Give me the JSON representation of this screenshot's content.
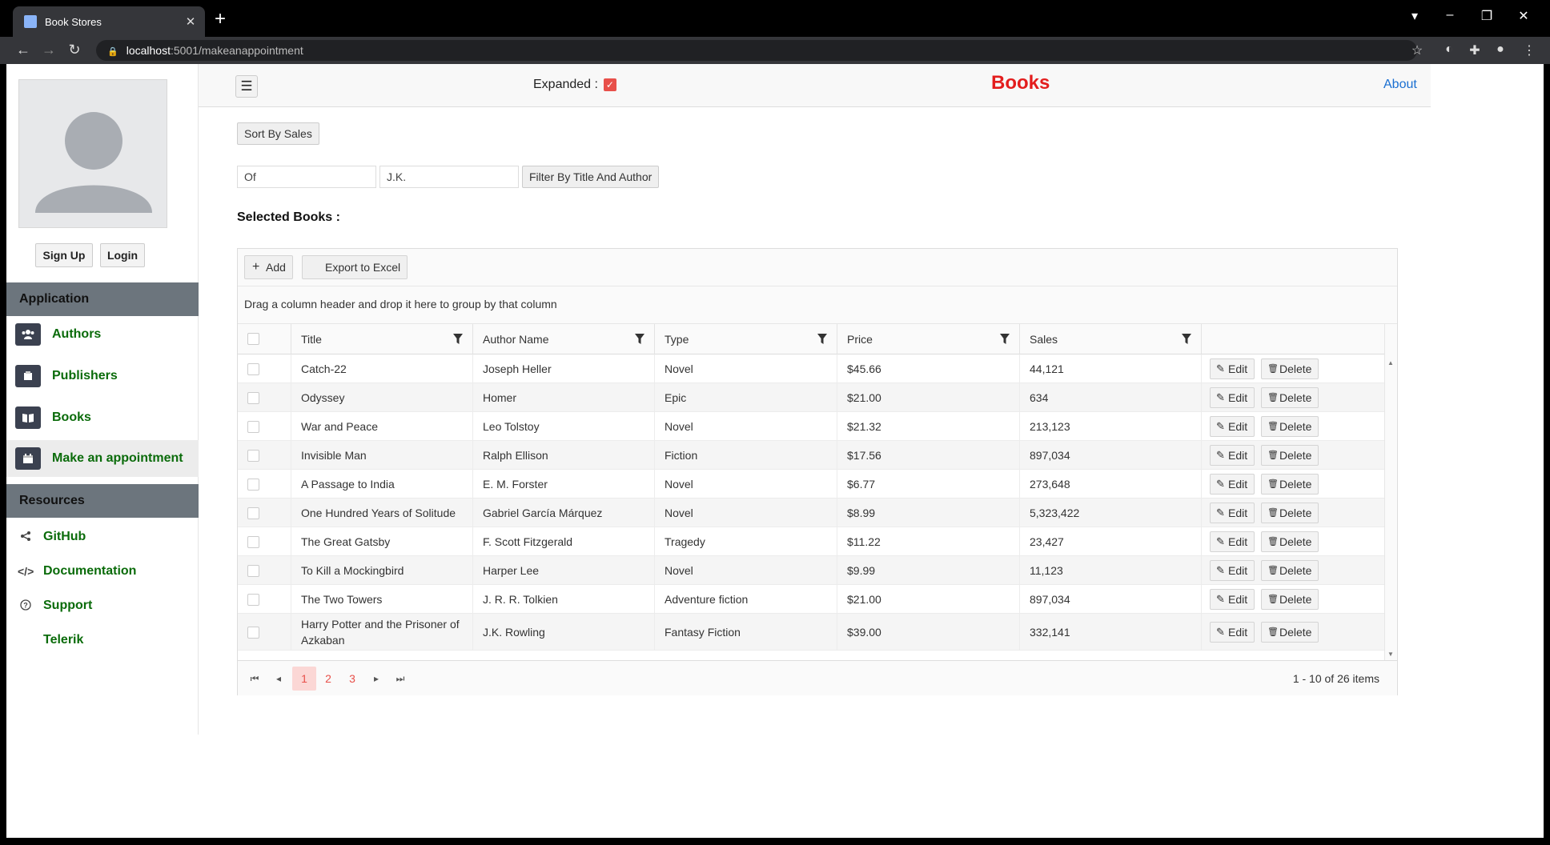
{
  "browser": {
    "tab_title": "Book Stores",
    "url_host": "localhost",
    "url_rest": ":5001/makeanappointment"
  },
  "sidebar": {
    "sign_up": "Sign Up",
    "login": "Login",
    "application_header": "Application",
    "app_items": [
      {
        "label": "Authors",
        "icon": "users-icon"
      },
      {
        "label": "Publishers",
        "icon": "publisher-icon"
      },
      {
        "label": "Books",
        "icon": "book-icon"
      },
      {
        "label": "Make an appointment",
        "icon": "calendar-icon"
      }
    ],
    "resources_header": "Resources",
    "resource_items": [
      {
        "label": "GitHub",
        "icon": "share-icon"
      },
      {
        "label": "Documentation",
        "icon": "code-icon"
      },
      {
        "label": "Support",
        "icon": "question-icon"
      },
      {
        "label": "Telerik",
        "icon": ""
      }
    ]
  },
  "header": {
    "expanded_label": "Expanded :",
    "title": "Books",
    "about": "About",
    "colors": {
      "title": "#e31d1d",
      "accent": "#e8504a",
      "link": "#1a6fd1",
      "nav": "#0a6b0a"
    }
  },
  "controls": {
    "sort_button": "Sort By Sales",
    "title_filter_value": "Of",
    "author_filter_value": "J.K.",
    "filter_button": "Filter By Title And Author",
    "selected_books": "Selected Books :"
  },
  "grid": {
    "add": "Add",
    "export": "Export to Excel",
    "group_hint": "Drag a column header and drop it here to group by that column",
    "columns": [
      "Title",
      "Author Name",
      "Type",
      "Price",
      "Sales"
    ],
    "edit": "Edit",
    "delete": "Delete",
    "rows": [
      [
        "Catch-22",
        "Joseph Heller",
        "Novel",
        "$45.66",
        "44,121"
      ],
      [
        "Odyssey",
        "Homer",
        "Epic",
        "$21.00",
        "634"
      ],
      [
        "War and Peace",
        "Leo Tolstoy",
        "Novel",
        "$21.32",
        "213,123"
      ],
      [
        "Invisible Man",
        "Ralph Ellison",
        "Fiction",
        "$17.56",
        "897,034"
      ],
      [
        "A Passage to India",
        "E. M. Forster",
        "Novel",
        "$6.77",
        "273,648"
      ],
      [
        "One Hundred Years of Solitude",
        "Gabriel García Márquez",
        "Novel",
        "$8.99",
        "5,323,422"
      ],
      [
        "The Great Gatsby",
        "F. Scott Fitzgerald",
        "Tragedy",
        "$11.22",
        "23,427"
      ],
      [
        "To Kill a Mockingbird",
        "Harper Lee",
        "Novel",
        "$9.99",
        "11,123"
      ],
      [
        "The Two Towers",
        "J. R. R. Tolkien",
        "Adventure fiction",
        "$21.00",
        "897,034"
      ],
      [
        "Harry Potter and the Prisoner of Azkaban",
        "J.K. Rowling",
        "Fantasy Fiction",
        "$39.00",
        "332,141"
      ]
    ],
    "pages": [
      "1",
      "2",
      "3"
    ],
    "current_page": "1",
    "pager_info": "1 - 10 of 26 items"
  }
}
